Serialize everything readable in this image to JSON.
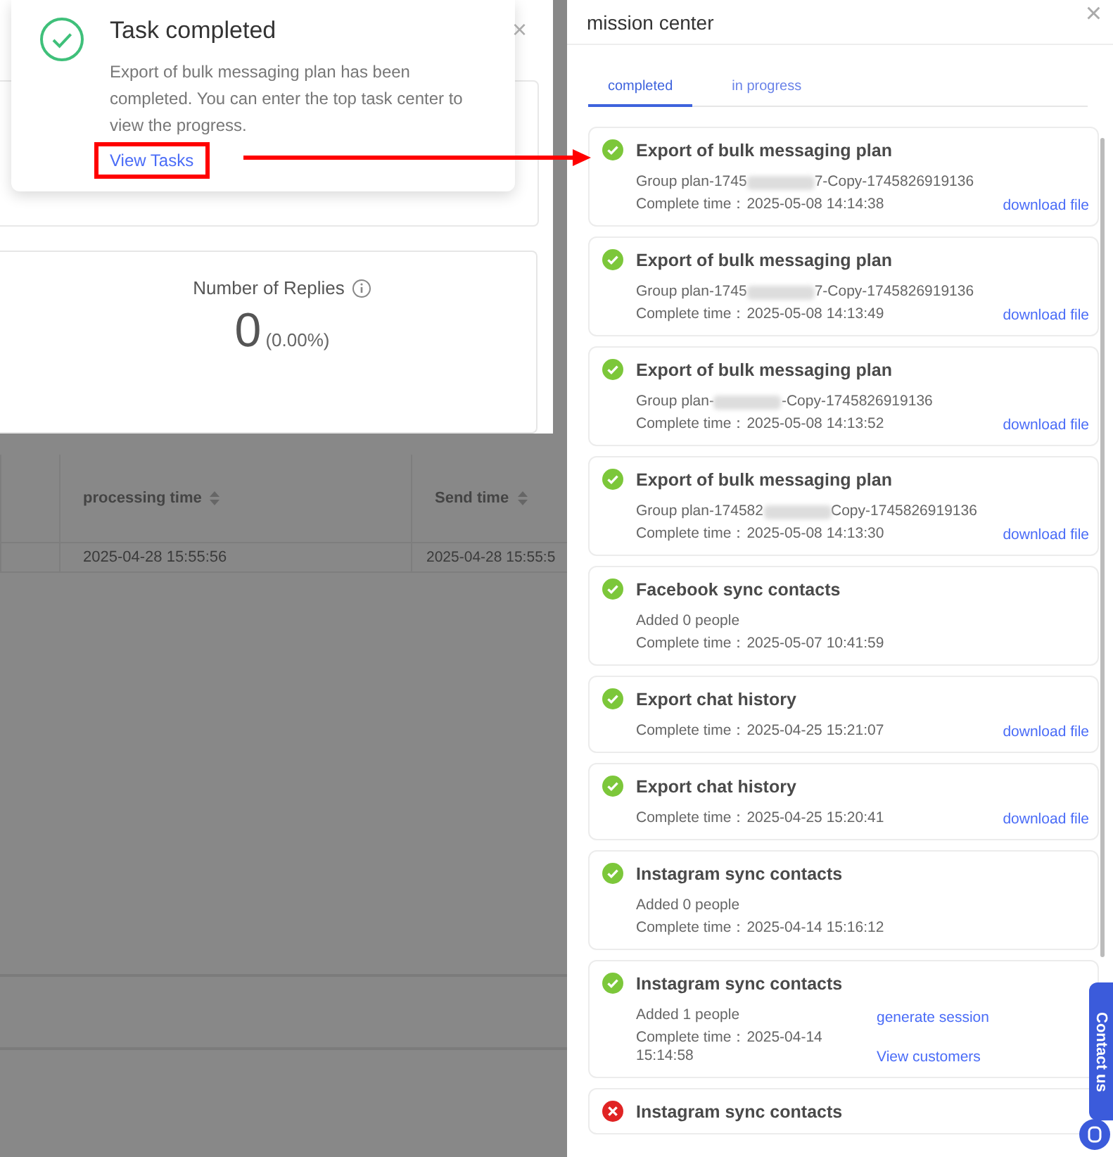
{
  "notification": {
    "title": "Task completed",
    "message": "Export of bulk messaging plan has been completed. You can enter the top task center to view the progress.",
    "link": "View Tasks",
    "close": "×"
  },
  "stat_card": {
    "label": "Number of Replies",
    "value": "0",
    "percent": "(0.00%)"
  },
  "table": {
    "columns": [
      "processing time",
      "Send time"
    ],
    "rows": [
      [
        "2025-04-28 15:55:56",
        "2025-04-28 15:55:5"
      ]
    ]
  },
  "drawer": {
    "title": "mission center",
    "close": "×",
    "tabs": [
      {
        "label": "completed",
        "selected": true
      },
      {
        "label": "in progress",
        "selected": false
      }
    ],
    "items": [
      {
        "failed": false,
        "title": "Export of bulk messaging plan",
        "lines": [
          {
            "kind": "masked",
            "prefix": "Group plan-1745",
            "suffix": "7-Copy-1745826919136"
          },
          {
            "kind": "text",
            "text": "Complete time：2025-05-08 14:14:38"
          }
        ],
        "actions": [
          "download file"
        ]
      },
      {
        "failed": false,
        "title": "Export of bulk messaging plan",
        "lines": [
          {
            "kind": "masked",
            "prefix": "Group plan-1745",
            "suffix": "7-Copy-1745826919136"
          },
          {
            "kind": "text",
            "text": "Complete time：2025-05-08 14:13:49"
          }
        ],
        "actions": [
          "download file"
        ]
      },
      {
        "failed": false,
        "title": "Export of bulk messaging plan",
        "lines": [
          {
            "kind": "masked",
            "prefix": "Group plan-",
            "suffix": "-Copy-1745826919136"
          },
          {
            "kind": "text",
            "text": "Complete time：2025-05-08 14:13:52"
          }
        ],
        "actions": [
          "download file"
        ]
      },
      {
        "failed": false,
        "title": "Export of bulk messaging plan",
        "lines": [
          {
            "kind": "masked",
            "prefix": "Group plan-174582",
            "suffix": "Copy-1745826919136"
          },
          {
            "kind": "text",
            "text": "Complete time：2025-05-08 14:13:30"
          }
        ],
        "actions": [
          "download file"
        ]
      },
      {
        "failed": false,
        "title": "Facebook sync contacts",
        "lines": [
          {
            "kind": "text",
            "text": "Added 0 people"
          },
          {
            "kind": "text",
            "text": "Complete time：2025-05-07 10:41:59"
          }
        ]
      },
      {
        "failed": false,
        "title": "Export chat history",
        "lines": [
          {
            "kind": "text",
            "text": "Complete time：2025-04-25 15:21:07"
          }
        ],
        "actions": [
          "download file"
        ]
      },
      {
        "failed": false,
        "title": "Export chat history",
        "lines": [
          {
            "kind": "text",
            "text": "Complete time：2025-04-25 15:20:41"
          }
        ],
        "actions": [
          "download file"
        ]
      },
      {
        "failed": false,
        "title": "Instagram sync contacts",
        "lines": [
          {
            "kind": "text",
            "text": "Added 0 people"
          },
          {
            "kind": "text",
            "text": "Complete time：2025-04-14 15:16:12"
          }
        ]
      },
      {
        "failed": false,
        "title": "Instagram sync contacts",
        "lines": [
          {
            "kind": "text",
            "text": "Added 1 people"
          },
          {
            "kind": "text",
            "text": "Complete time：2025-04-14 15:14:58"
          }
        ],
        "actions": [
          "generate session",
          "View customers"
        ]
      },
      {
        "failed": true,
        "title": "Instagram sync contacts"
      }
    ]
  },
  "contact_tab": {
    "label": "Contact us"
  }
}
